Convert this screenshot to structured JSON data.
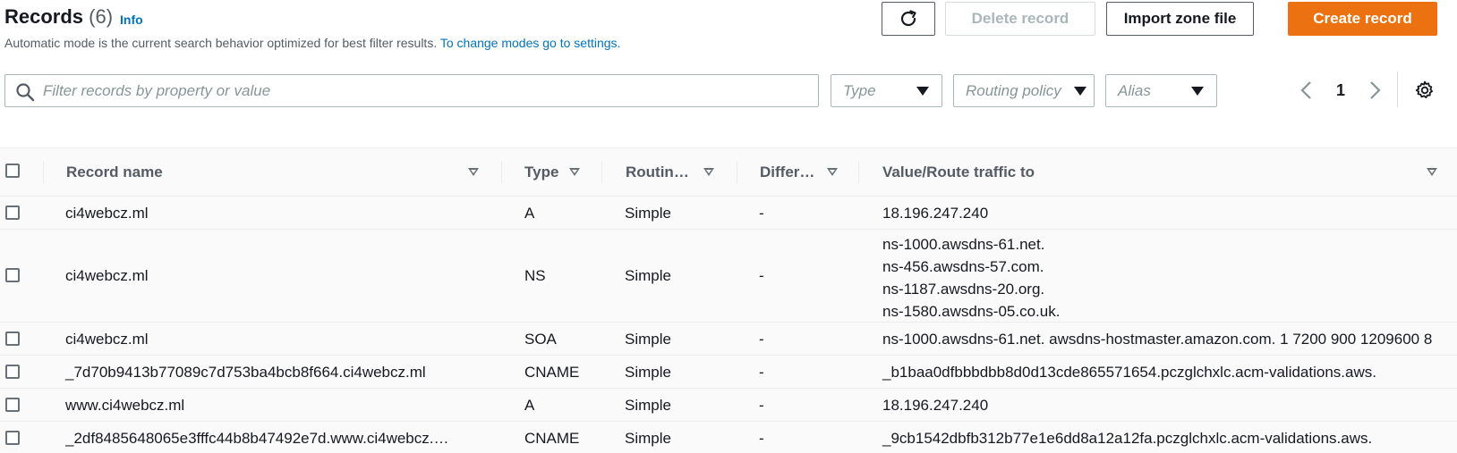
{
  "header": {
    "title": "Records",
    "count": "(6)",
    "info_label": "Info",
    "description": "Automatic mode is the current search behavior optimized for best filter results.",
    "description_link": "To change modes go to settings."
  },
  "toolbar": {
    "refresh_icon": "refresh-icon",
    "delete_label": "Delete record",
    "import_label": "Import zone file",
    "create_label": "Create record"
  },
  "filters": {
    "search_placeholder": "Filter records by property or value",
    "type_placeholder": "Type",
    "routing_placeholder": "Routing policy",
    "alias_placeholder": "Alias"
  },
  "pagination": {
    "current_page": "1"
  },
  "colors": {
    "accent": "#ec7211",
    "link": "#0073bb"
  },
  "table": {
    "columns": {
      "name": "Record name",
      "type": "Type",
      "routing": "Routin…",
      "differ": "Differ…",
      "value": "Value/Route traffic to"
    },
    "rows": [
      {
        "name": "ci4webcz.ml",
        "type": "A",
        "routing": "Simple",
        "differ": "-",
        "value": [
          "18.196.247.240"
        ]
      },
      {
        "name": "ci4webcz.ml",
        "type": "NS",
        "routing": "Simple",
        "differ": "-",
        "value": [
          "ns-1000.awsdns-61.net.",
          "ns-456.awsdns-57.com.",
          "ns-1187.awsdns-20.org.",
          "ns-1580.awsdns-05.co.uk."
        ]
      },
      {
        "name": "ci4webcz.ml",
        "type": "SOA",
        "routing": "Simple",
        "differ": "-",
        "value": [
          "ns-1000.awsdns-61.net. awsdns-hostmaster.amazon.com. 1 7200 900 1209600 8"
        ]
      },
      {
        "name": "_7d70b9413b77089c7d753ba4bcb8f664.ci4webcz.ml",
        "type": "CNAME",
        "routing": "Simple",
        "differ": "-",
        "value": [
          "_b1baa0dfbbbdbb8d0d13cde865571654.pczglchxlc.acm-validations.aws."
        ]
      },
      {
        "name": "www.ci4webcz.ml",
        "type": "A",
        "routing": "Simple",
        "differ": "-",
        "value": [
          "18.196.247.240"
        ]
      },
      {
        "name": "_2df8485648065e3fffc44b8b47492e7d.www.ci4webcz.…",
        "type": "CNAME",
        "routing": "Simple",
        "differ": "-",
        "value": [
          "_9cb1542dbfb312b77e1e6dd8a12a12fa.pczglchxlc.acm-validations.aws."
        ]
      }
    ]
  }
}
